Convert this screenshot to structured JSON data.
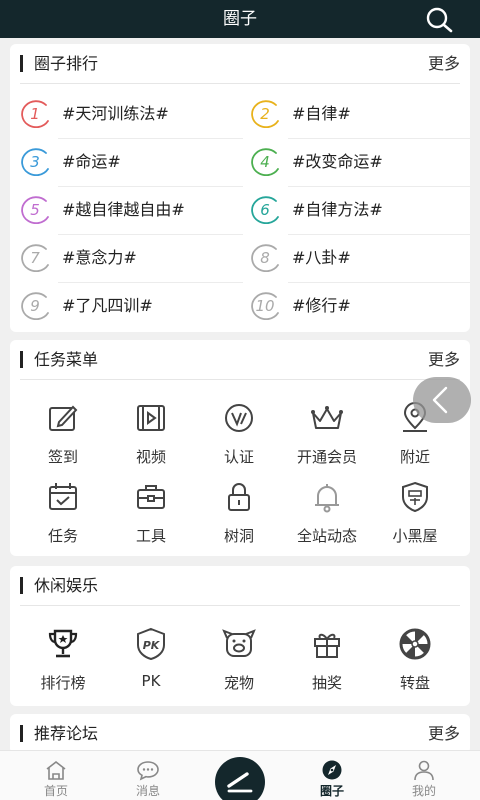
{
  "header": {
    "title": "圈子"
  },
  "rank_section": {
    "title": "圈子排行",
    "more": "更多",
    "items": [
      {
        "num": "1",
        "tag": "#天河训练法#",
        "color": "#e35b5b"
      },
      {
        "num": "2",
        "tag": "#自律#",
        "color": "#e8b21c"
      },
      {
        "num": "3",
        "tag": "#命运#",
        "color": "#3a9ad9"
      },
      {
        "num": "4",
        "tag": "#改变命运#",
        "color": "#4caf50"
      },
      {
        "num": "5",
        "tag": "#越自律越自由#",
        "color": "#c06dd0"
      },
      {
        "num": "6",
        "tag": "#自律方法#",
        "color": "#26a69a"
      },
      {
        "num": "7",
        "tag": "#意念力#",
        "color": "#aaaaaa"
      },
      {
        "num": "8",
        "tag": "#八卦#",
        "color": "#aaaaaa"
      },
      {
        "num": "9",
        "tag": "#了凡四训#",
        "color": "#aaaaaa"
      },
      {
        "num": "10",
        "tag": "#修行#",
        "color": "#aaaaaa"
      }
    ]
  },
  "task_section": {
    "title": "任务菜单",
    "more": "更多",
    "items": [
      {
        "label": "签到",
        "icon": "edit-icon"
      },
      {
        "label": "视频",
        "icon": "video-icon"
      },
      {
        "label": "认证",
        "icon": "verify-icon"
      },
      {
        "label": "开通会员",
        "icon": "crown-icon"
      },
      {
        "label": "附近",
        "icon": "location-icon"
      },
      {
        "label": "任务",
        "icon": "calendar-check-icon"
      },
      {
        "label": "工具",
        "icon": "toolbox-icon"
      },
      {
        "label": "树洞",
        "icon": "lock-icon"
      },
      {
        "label": "全站动态",
        "icon": "bell-icon"
      },
      {
        "label": "小黑屋",
        "icon": "penalty-icon"
      }
    ]
  },
  "leisure_section": {
    "title": "休闲娱乐",
    "items": [
      {
        "label": "排行榜",
        "icon": "trophy-icon"
      },
      {
        "label": "PK",
        "icon": "pk-icon"
      },
      {
        "label": "宠物",
        "icon": "pet-icon"
      },
      {
        "label": "抽奖",
        "icon": "gift-icon"
      },
      {
        "label": "转盘",
        "icon": "wheel-icon"
      }
    ]
  },
  "forum_section": {
    "title": "推荐论坛",
    "more": "更多"
  },
  "tabbar": {
    "items": [
      {
        "label": "首页",
        "icon": "home-icon"
      },
      {
        "label": "消息",
        "icon": "message-icon"
      },
      {
        "label": "",
        "icon": "compose-icon"
      },
      {
        "label": "圈子",
        "icon": "compass-icon"
      },
      {
        "label": "我的",
        "icon": "user-icon"
      }
    ]
  }
}
